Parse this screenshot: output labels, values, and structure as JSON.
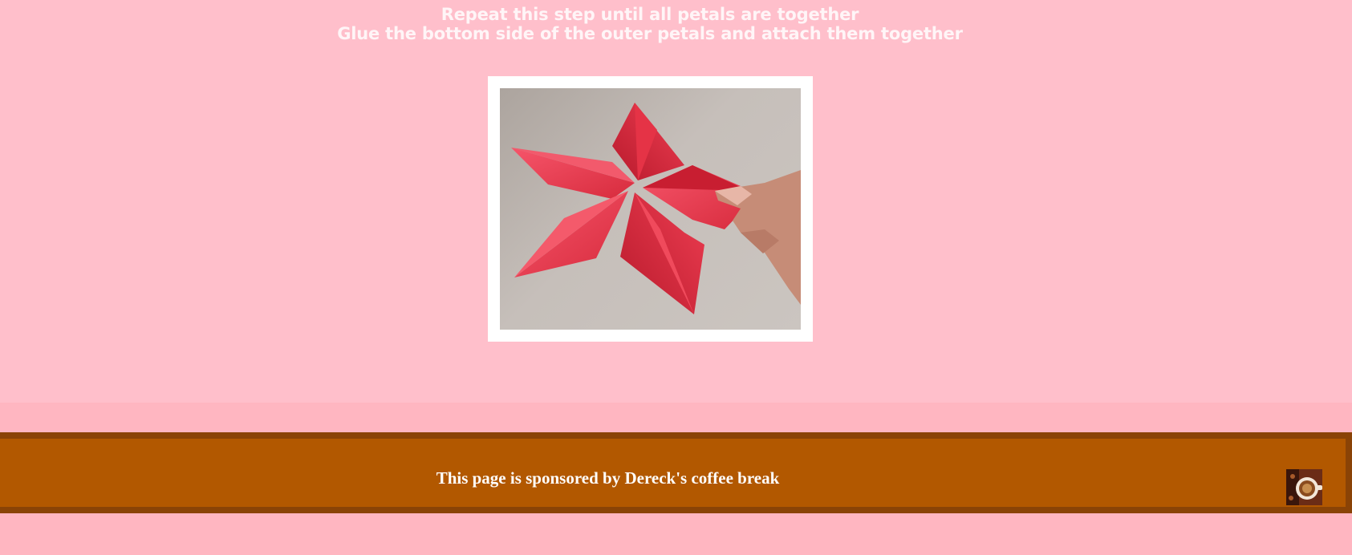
{
  "instructions": {
    "line1": "Repeat this step until all petals are together",
    "line2": "Glue the bottom side of the outer petals and attach them together"
  },
  "photo": {
    "subject": "pink origami flower with five petals held by a hand",
    "icon": "origami-flower-photo"
  },
  "footer": {
    "sponsor_text": "This page is sponsored by Dereck's coffee break",
    "thumbnail_icon": "coffee-cup-icon"
  },
  "colors": {
    "page_background": "#ffb6c1",
    "content_background": "#ffbfcb",
    "heading_text": "#fff5f7",
    "footer_background": "#b25800",
    "footer_border": "#8a4306",
    "petal": "#f0404f"
  }
}
